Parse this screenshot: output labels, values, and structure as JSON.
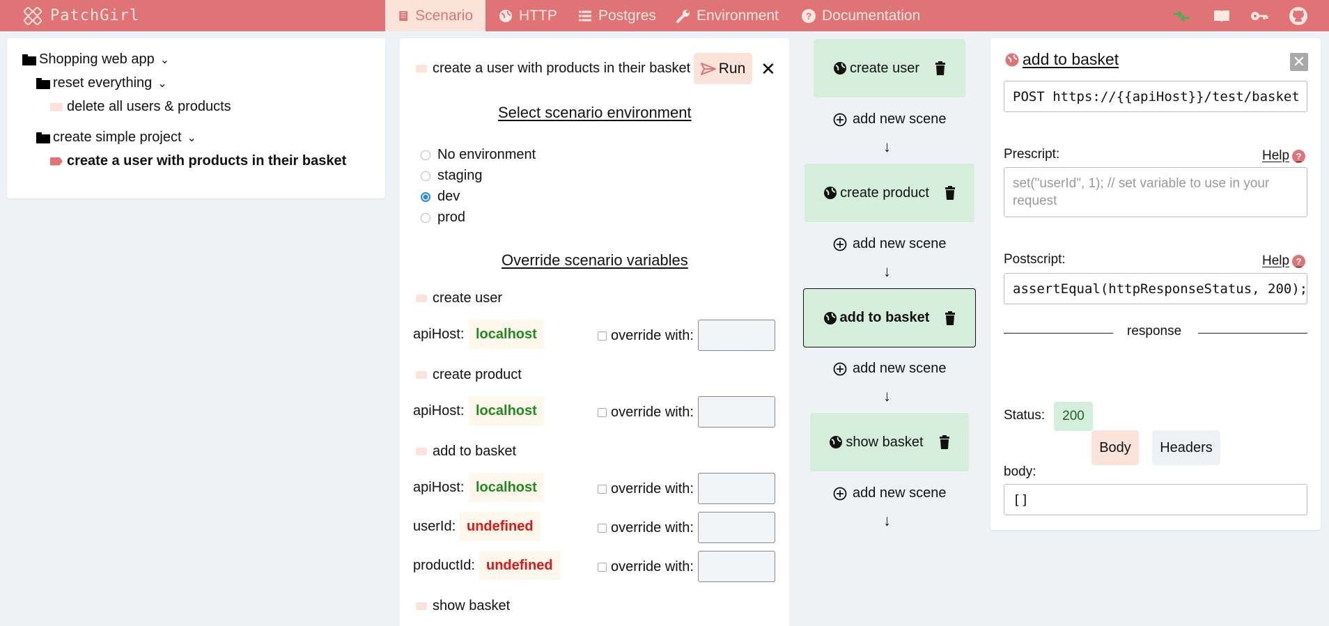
{
  "nav": {
    "brand": "PatchGirl",
    "tabs": [
      {
        "label": "Scenario",
        "icon": "scenario-icon",
        "active": true
      },
      {
        "label": "HTTP",
        "icon": "globe-icon"
      },
      {
        "label": "Postgres",
        "icon": "list-icon"
      },
      {
        "label": "Environment",
        "icon": "wrench-icon"
      },
      {
        "label": "Documentation",
        "icon": "question-icon"
      }
    ],
    "right_icons": [
      "sync-icon",
      "book-icon",
      "key-icon",
      "github-icon"
    ]
  },
  "tree": {
    "root": {
      "label": "Shopping web app"
    },
    "folders": [
      {
        "label": "reset everything",
        "children": [
          {
            "label": "delete all users & products"
          }
        ]
      },
      {
        "label": "create simple project",
        "children": [
          {
            "label": "create a user with products in their basket",
            "selected": true
          }
        ]
      }
    ]
  },
  "scenario": {
    "name": "create a user with products in their basket",
    "run_label": "Run",
    "env_heading": "Select scenario environment",
    "environments": [
      {
        "label": "No environment",
        "checked": false
      },
      {
        "label": "staging",
        "checked": false
      },
      {
        "label": "dev",
        "checked": true
      },
      {
        "label": "prod",
        "checked": false
      }
    ],
    "override_heading": "Override scenario variables",
    "override_label": "override with:",
    "groups": [
      {
        "scene": "create user",
        "vars": [
          {
            "name": "apiHost:",
            "value": "localhost",
            "status": "ok"
          }
        ]
      },
      {
        "scene": "create product",
        "vars": [
          {
            "name": "apiHost:",
            "value": "localhost",
            "status": "ok"
          }
        ]
      },
      {
        "scene": "add to basket",
        "vars": [
          {
            "name": "apiHost:",
            "value": "localhost",
            "status": "ok"
          },
          {
            "name": "userId:",
            "value": "undefined",
            "status": "bad"
          },
          {
            "name": "productId:",
            "value": "undefined",
            "status": "bad"
          }
        ]
      },
      {
        "scene": "show basket",
        "vars": []
      }
    ]
  },
  "scenes": {
    "items": [
      {
        "label": "create user",
        "selected": false
      },
      {
        "label": "create product",
        "selected": false
      },
      {
        "label": "add to basket",
        "selected": true
      },
      {
        "label": "show basket",
        "selected": false
      }
    ],
    "add_label": "add new scene"
  },
  "request": {
    "title": "add to basket",
    "url": "POST https://{{apiHost}}/test/basket",
    "prescript_label": "Prescript:",
    "help_label": "Help",
    "prescript_placeholder": "set(\"userId\", 1); // set variable to use in your request",
    "postscript_label": "Postscript:",
    "postscript_value": "assertEqual(httpResponseStatus, 200);",
    "response_label": "response",
    "status_label": "Status:",
    "status_value": "200",
    "body_tab": "Body",
    "headers_tab": "Headers",
    "body_label": "body:",
    "body_value": "[]"
  },
  "colors": {
    "brand": "#df7375",
    "accent_light": "#fbe3d9",
    "scene_bg": "#d4eedb",
    "ok": "#1f8a1f",
    "bad": "#e01515"
  }
}
